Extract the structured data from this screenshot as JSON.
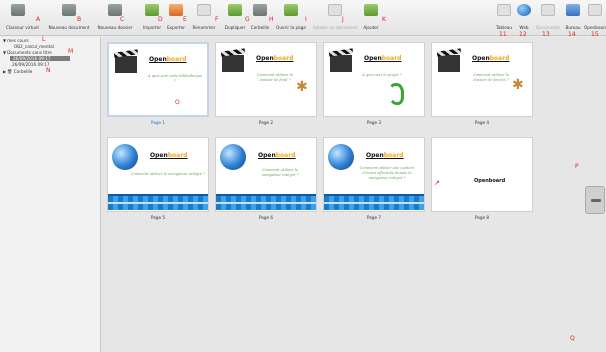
{
  "toolbar": {
    "items": [
      {
        "label": "Classeur virtuel",
        "marker": "A",
        "icon": "virtual-binder-icon"
      },
      {
        "label": "Nouveau document",
        "marker": "B",
        "icon": "new-document-icon"
      },
      {
        "label": "Nouveau dossier",
        "marker": "C",
        "icon": "new-folder-icon"
      },
      {
        "label": "Importer",
        "marker": "D",
        "icon": "import-icon"
      },
      {
        "label": "Exporter",
        "marker": "E",
        "icon": "export-icon"
      },
      {
        "label": "Renommer",
        "marker": "F",
        "icon": "rename-icon"
      },
      {
        "label": "Dupliquer",
        "marker": "G",
        "icon": "duplicate-icon"
      },
      {
        "label": "Corbeille",
        "marker": "H",
        "icon": "trash-icon"
      },
      {
        "label": "Ouvrir la page",
        "marker": "I",
        "icon": "open-page-icon"
      },
      {
        "label": "Ajouter au document",
        "marker": "J",
        "icon": "add-to-document-icon"
      },
      {
        "label": "Ajouter",
        "marker": "K",
        "icon": "add-icon"
      },
      {
        "label": "Tableau",
        "marker": "11",
        "icon": "board-icon"
      },
      {
        "label": "Web",
        "marker": "12",
        "icon": "web-globe-icon"
      },
      {
        "label": "Documents",
        "marker": "13",
        "icon": "documents-icon"
      },
      {
        "label": "Bureau",
        "marker": "14",
        "icon": "desktop-icon"
      },
      {
        "label": "Openboard",
        "marker": "15",
        "icon": "openboard-icon"
      }
    ]
  },
  "sidebar": {
    "root": {
      "label": "mes cours",
      "marker": "L"
    },
    "child": {
      "label": "OB2_calcul_mental"
    },
    "group": {
      "label": "Documents sans titre",
      "marker": "M"
    },
    "selected_doc": {
      "label": "26/09/2016 09:17"
    },
    "other_doc": {
      "label": "26/09/2016 09:17"
    },
    "trash": {
      "label": "Corbeille",
      "marker": "N"
    }
  },
  "main": {
    "markers": {
      "o": "O",
      "p": "P",
      "q": "Q"
    },
    "brand": {
      "open": "Open",
      "board": "board"
    },
    "pages": [
      {
        "label": "Page 1",
        "caption": "À quoi sert cette bibliothèque ?"
      },
      {
        "label": "Page 2",
        "caption": "Comment utiliser le dossier de fond ?"
      },
      {
        "label": "Page 3",
        "caption": "À quoi sert le projet ?"
      },
      {
        "label": "Page 4",
        "caption": "Comment utiliser le dossier de favoris ?"
      },
      {
        "label": "Page 5",
        "caption": "Comment utiliser le navigateur intégré ?"
      },
      {
        "label": "Page 6",
        "caption": "Comment utiliser le navigateur intégré ?"
      },
      {
        "label": "Page 7",
        "caption": "Comment utiliser une capture d'écran effectuée depuis le navigateur intégré ?"
      },
      {
        "label": "Page 8",
        "caption": "Openboard"
      }
    ]
  }
}
